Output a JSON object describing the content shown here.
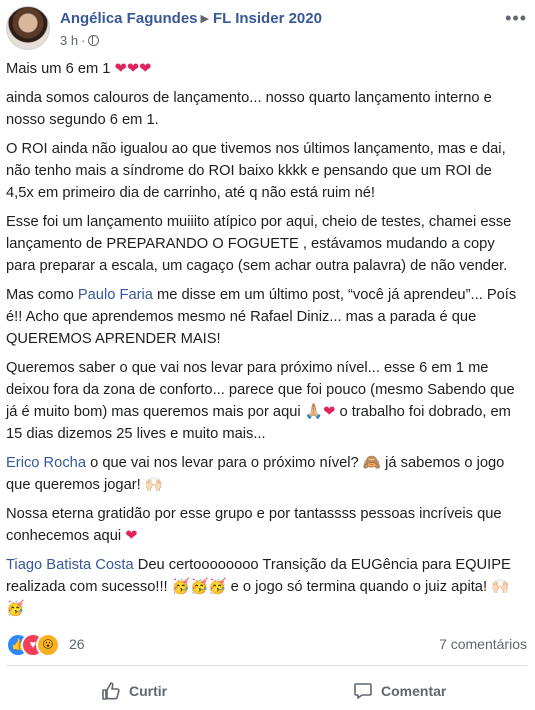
{
  "post": {
    "author": "Angélica Fagundes",
    "group": "FL Insider 2020",
    "time": "3 h",
    "paragraphs": [
      {
        "segments": [
          {
            "text": "Mais um 6 em 1 "
          },
          {
            "text": "❤❤❤",
            "heart": true
          }
        ]
      },
      {
        "segments": [
          {
            "text": "ainda somos calouros de lançamento... nosso quarto lançamento interno e nosso segundo 6 em 1."
          }
        ]
      },
      {
        "segments": [
          {
            "text": "O ROI ainda não igualou ao que tivemos nos últimos lançamento, mas e dai, não tenho mais a síndrome do ROI baixo kkkk e pensando que um ROI de 4,5x em primeiro dia de carrinho, até q não está ruim né!"
          }
        ]
      },
      {
        "segments": [
          {
            "text": "Esse foi um lançamento muiiito atípico por aqui, cheio de testes, chamei esse lançamento de PREPARANDO O FOGUETE , estávamos mudando a copy para preparar a escala, um cagaço (sem achar outra palavra) de não vender."
          }
        ]
      },
      {
        "segments": [
          {
            "text": "Mas como "
          },
          {
            "text": "Paulo Faria",
            "link": true
          },
          {
            "text": " me disse em um último post, “você já aprendeu”... Poís é!! Acho que aprendemos mesmo né Rafael Diniz... mas a parada é que QUEREMOS APRENDER MAIS!"
          }
        ]
      },
      {
        "segments": [
          {
            "text": "Queremos saber o que vai nos levar para próximo nível... esse 6 em 1 me deixou fora da zona de conforto... parece que foi pouco (mesmo Sabendo que já é muito bom) mas queremos mais por aqui 🙏🏼"
          },
          {
            "text": "❤",
            "heart": true
          },
          {
            "text": " o trabalho foi dobrado, em 15 dias dizemos 25 lives e muito mais..."
          }
        ]
      },
      {
        "segments": [
          {
            "text": "Erico Rocha",
            "link": true
          },
          {
            "text": " o que vai nos levar para o próximo nível? 🙈 já sabemos o jogo que queremos jogar! 🙌🏻"
          }
        ]
      },
      {
        "segments": [
          {
            "text": "Nossa eterna gratidão por esse grupo e por tantassss pessoas incríveis que conhecemos aqui "
          },
          {
            "text": "❤",
            "heart": true
          }
        ]
      },
      {
        "segments": [
          {
            "text": "Tiago Batista Costa",
            "link": true
          },
          {
            "text": " Deu certoooooooo Transição da EUGência para EQUIPE realizada com sucesso!!! 🥳🥳🥳 e o jogo só termina quando o juiz apita! 🙌🏻🥳"
          }
        ]
      }
    ]
  },
  "reactions": {
    "count": "26",
    "like_glyph": "👍",
    "love_glyph": "♥",
    "wow_glyph": "😮"
  },
  "comments": {
    "count_label": "7 comentários"
  },
  "actions": {
    "like_label": "Curtir",
    "comment_label": "Comentar"
  },
  "icons": {
    "more": "more-horizontal-icon",
    "privacy": "globe-icon",
    "like": "thumbs-up-icon",
    "comment": "speech-bubble-icon"
  }
}
